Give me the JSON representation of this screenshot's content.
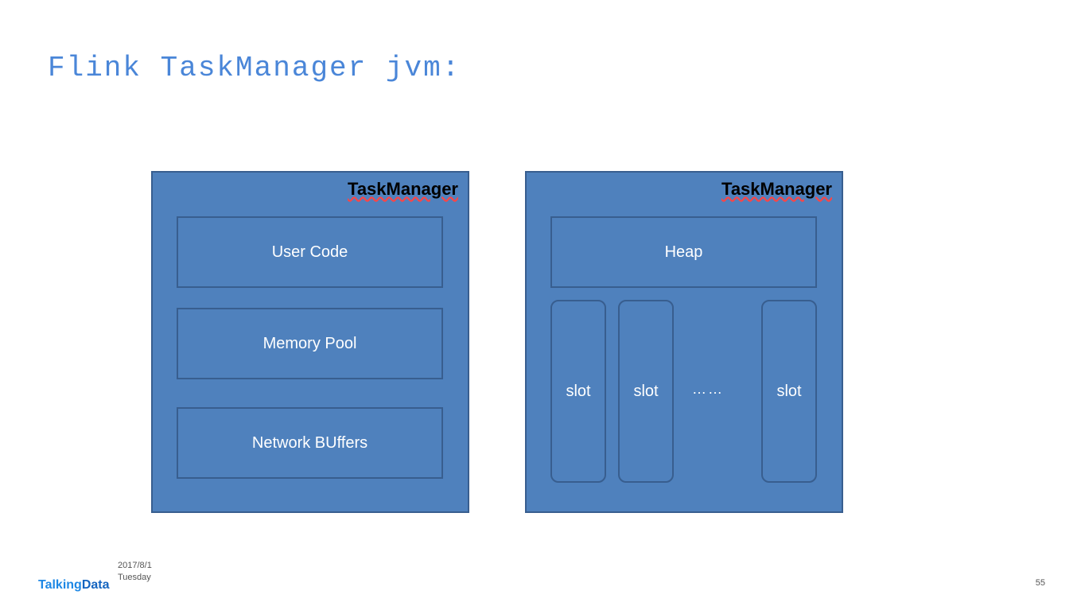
{
  "title": "Flink TaskManager jvm:",
  "diagram": {
    "left_box": {
      "label": "TaskManager",
      "rows": [
        "User Code",
        "Memory Pool",
        "Network BUffers"
      ]
    },
    "right_box": {
      "label": "TaskManager",
      "heap_label": "Heap",
      "slot_label": "slot",
      "ellipsis": "……"
    }
  },
  "footer": {
    "logo_part1": "Talking",
    "logo_part2": "Data",
    "date": "2017/8/1",
    "day": "Tuesday",
    "page_number": "55"
  }
}
